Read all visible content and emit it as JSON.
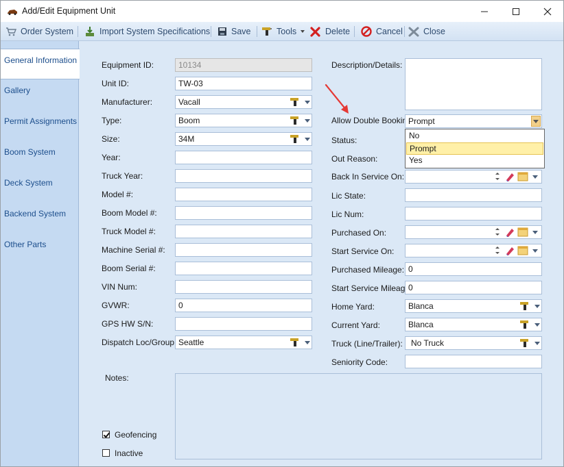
{
  "window": {
    "title": "Add/Edit Equipment Unit"
  },
  "toolbar": {
    "order_system": "Order System",
    "import_specs": "Import System Specifications",
    "save": "Save",
    "tools": "Tools",
    "delete": "Delete",
    "cancel": "Cancel",
    "close": "Close"
  },
  "tabs": [
    "General Information",
    "Gallery",
    "Permit Assignments",
    "Boom System",
    "Deck System",
    "Backend System",
    "Other Parts"
  ],
  "left_fields": {
    "equipment_id": {
      "label": "Equipment ID:",
      "value": "10134"
    },
    "unit_id": {
      "label": "Unit ID:",
      "value": "TW-03"
    },
    "manufacturer": {
      "label": "Manufacturer:",
      "value": "Vacall"
    },
    "type": {
      "label": "Type:",
      "value": "Boom"
    },
    "size": {
      "label": "Size:",
      "value": "34M"
    },
    "year": {
      "label": "Year:",
      "value": ""
    },
    "truck_year": {
      "label": "Truck Year:",
      "value": ""
    },
    "model": {
      "label": "Model #:",
      "value": ""
    },
    "boom_model": {
      "label": "Boom Model #:",
      "value": ""
    },
    "truck_model": {
      "label": "Truck Model #:",
      "value": ""
    },
    "machine_serial": {
      "label": "Machine Serial #:",
      "value": ""
    },
    "boom_serial": {
      "label": "Boom Serial #:",
      "value": ""
    },
    "vin": {
      "label": "VIN Num:",
      "value": ""
    },
    "gvwr": {
      "label": "GVWR:",
      "value": "0"
    },
    "gps": {
      "label": "GPS HW S/N:",
      "value": ""
    },
    "dispatch": {
      "label": "Dispatch Loc/Group:",
      "value": "Seattle"
    }
  },
  "right_fields": {
    "description": {
      "label": "Description/Details:",
      "value": ""
    },
    "allow_double_booking": {
      "label": "Allow Double Booking:",
      "value": "Prompt",
      "options": [
        "No",
        "Prompt",
        "Yes"
      ],
      "highlighted": "Prompt"
    },
    "status": {
      "label": "Status:"
    },
    "out_reason": {
      "label": "Out Reason:"
    },
    "back_in_service": {
      "label": "Back In Service On:",
      "value": ""
    },
    "lic_state": {
      "label": "Lic State:",
      "value": ""
    },
    "lic_num": {
      "label": "Lic Num:",
      "value": ""
    },
    "purchased_on": {
      "label": "Purchased On:",
      "value": ""
    },
    "start_service_on": {
      "label": "Start Service On:",
      "value": ""
    },
    "purchased_mileage": {
      "label": "Purchased Mileage:",
      "value": "0"
    },
    "start_service_mileage": {
      "label": "Start Service Mileage:",
      "value": "0"
    },
    "home_yard": {
      "label": "Home Yard:",
      "value": "Blanca"
    },
    "current_yard": {
      "label": "Current Yard:",
      "value": "Blanca"
    },
    "truck_line_trailer": {
      "label": "Truck (Line/Trailer):",
      "value": "No Truck"
    },
    "seniority_code": {
      "label": "Seniority Code:",
      "value": ""
    }
  },
  "notes": {
    "label": "Notes:"
  },
  "checkboxes": {
    "geofencing": {
      "label": "Geofencing",
      "checked": true
    },
    "inactive": {
      "label": "Inactive",
      "checked": false
    }
  },
  "colors": {
    "toolbar_text": "#2d4a6e",
    "tab_text": "#1c4e8c",
    "panel_bg": "#dbe8f6",
    "highlight": "#fff0a8",
    "annotation_arrow": "#e53935"
  }
}
